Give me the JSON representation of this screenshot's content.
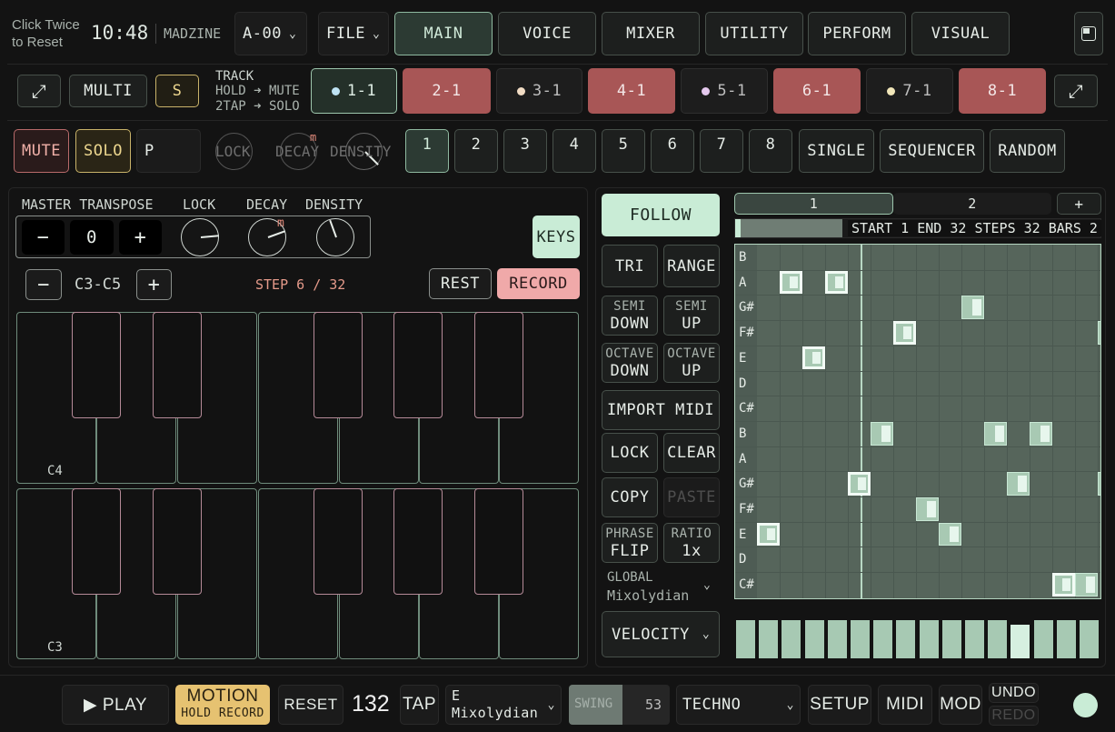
{
  "header": {
    "click_twice": "Click Twice",
    "to_reset": "to Reset",
    "clock": "10:48",
    "app_name": "MADZINE",
    "preset": "A-00",
    "file_label": "FILE",
    "tabs": [
      "MAIN",
      "VOICE",
      "MIXER",
      "UTILITY",
      "PERFORM",
      "VISUAL"
    ],
    "active_tab": "MAIN"
  },
  "track_bar": {
    "multi": "MULTI",
    "s": "S",
    "hint_title": "TRACK",
    "hint_hold": "HOLD ➜ MUTE",
    "hint_2tap": "2TAP ➜ SOLO",
    "tracks": [
      "1-1",
      "2-1",
      "3-1",
      "4-1",
      "5-1",
      "6-1",
      "7-1",
      "8-1"
    ]
  },
  "row3": {
    "mute": "MUTE",
    "solo": "SOLO",
    "p": "P",
    "lock": "LOCK",
    "decay": "DECAY",
    "density": "DENSITY",
    "decay_badge": "m",
    "steps": [
      "1",
      "2",
      "3",
      "4",
      "5",
      "6",
      "7",
      "8"
    ],
    "single": "SINGLE",
    "sequencer": "SEQUENCER",
    "random": "RANDOM"
  },
  "left": {
    "master_transpose": "MASTER TRANSPOSE",
    "lock": "LOCK",
    "decay": "DECAY",
    "density": "DENSITY",
    "minus": "−",
    "plus": "+",
    "transpose_value": "0",
    "decay_badge": "m",
    "keys": "KEYS",
    "range": "C3-C5",
    "step_status": "STEP 6 / 32",
    "rest": "REST",
    "record": "RECORD",
    "octave_top": "C4",
    "octave_bottom": "C3"
  },
  "right": {
    "follow": "FOLLOW",
    "tri": "TRI",
    "range": "RANGE",
    "semi_down_a": "SEMI",
    "semi_down_b": "DOWN",
    "semi_up_a": "SEMI",
    "semi_up_b": "UP",
    "oct_down_a": "OCTAVE",
    "oct_down_b": "DOWN",
    "oct_up_a": "OCTAVE",
    "oct_up_b": "UP",
    "import_midi": "IMPORT MIDI",
    "lock": "LOCK",
    "clear": "CLEAR",
    "copy": "COPY",
    "paste": "PASTE",
    "phrase_a": "PHRASE",
    "phrase_b": "FLIP",
    "ratio_a": "RATIO",
    "ratio_b": "1x",
    "global_a": "GLOBAL",
    "global_b": "Mixolydian",
    "velocity": "VELOCITY",
    "pages": [
      "1",
      "2"
    ],
    "add_page": "+",
    "seq_info": "START 1 END 32 STEPS 32 BARS 2",
    "note_rows": [
      "B",
      "A",
      "G#",
      "F#",
      "E",
      "D",
      "C#",
      "B",
      "A",
      "G#",
      "F#",
      "E",
      "D",
      "C#"
    ],
    "velocities": [
      0.95,
      0.95,
      0.95,
      0.95,
      0.95,
      0.95,
      0.95,
      0.95,
      0.95,
      0.95,
      0.95,
      0.95,
      0.85,
      0.95,
      0.95,
      0.95
    ]
  },
  "footer": {
    "play": "▶ PLAY",
    "motion_a": "MOTION",
    "motion_b": "HOLD RECORD",
    "reset": "RESET",
    "bpm": "132",
    "tap": "TAP",
    "key": "E",
    "scale": "Mixolydian",
    "swing_label": "SWING",
    "swing_value": "53",
    "style": "TECHNO",
    "setup": "SETUP",
    "midi": "MIDI",
    "mod": "MOD",
    "undo": "UNDO",
    "redo": "REDO"
  },
  "colors": {
    "mint": "#c9ecd6",
    "track_red": "#a85656",
    "record_pink": "#f0a9a9",
    "grid_bg": "#56655b",
    "status_dot": "#c9ecd6"
  }
}
